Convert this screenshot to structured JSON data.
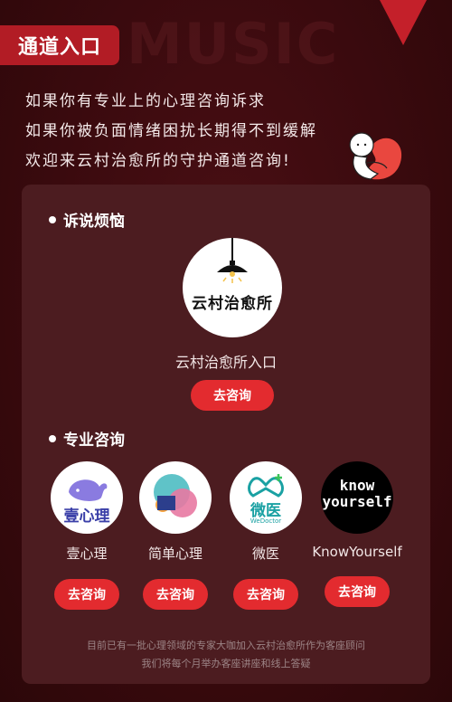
{
  "header": {
    "title": "通道入口",
    "watermark": "MUSIC"
  },
  "intro": {
    "lines": [
      "如果你有专业上的心理咨询诉求",
      "如果你被负面情绪困扰长期得不到缓解",
      "欢迎来云村治愈所的守护通道咨询!"
    ]
  },
  "section1": {
    "title": "诉说烦恼",
    "logo_text": "云村治愈所",
    "name": "云村治愈所入口",
    "button": "去咨询"
  },
  "section2": {
    "title": "专业咨询",
    "partners": [
      {
        "name": "壹心理",
        "logo_text": "壹心理",
        "button": "去咨询",
        "icon": "whale-icon"
      },
      {
        "name": "简单心理",
        "logo_text": "",
        "button": "去咨询",
        "icon": "overlapping-circles-icon"
      },
      {
        "name": "微医",
        "logo_text": "微医",
        "logo_sub": "WeDoctor",
        "button": "去咨询",
        "icon": "cross-icon"
      },
      {
        "name": "KnowYourself",
        "logo_text": "know",
        "logo_text2": "yourself",
        "button": "去咨询",
        "icon": "knowyourself-icon"
      }
    ]
  },
  "footer": {
    "line1": "目前已有一批心理领域的专家大咖加入云村治愈所作为客座顾问",
    "line2": "我们将每个月举办客座讲座和线上答疑"
  },
  "colors": {
    "background": "#3a0a0e",
    "card": "#4c1c20",
    "accent": "#e32b2f",
    "tag": "#b21c25"
  }
}
